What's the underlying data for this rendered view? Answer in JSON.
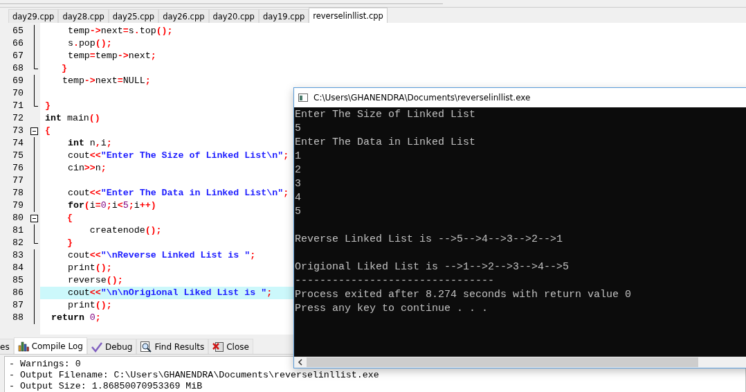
{
  "editor_tabs": [
    {
      "label": "day29.cpp",
      "selected": false
    },
    {
      "label": "day28.cpp",
      "selected": false
    },
    {
      "label": "day25.cpp",
      "selected": false
    },
    {
      "label": "day26.cpp",
      "selected": false
    },
    {
      "label": "day20.cpp",
      "selected": false
    },
    {
      "label": "day19.cpp",
      "selected": false
    },
    {
      "label": "reverselinllist.cpp",
      "selected": true
    }
  ],
  "code_lines": [
    {
      "number": "65",
      "kind": "inner",
      "current": false,
      "tokens": [
        {
          "kind": "plain",
          "text": "    temp"
        },
        {
          "kind": "symbol",
          "text": "->"
        },
        {
          "kind": "plain",
          "text": "next"
        },
        {
          "kind": "symbol",
          "text": "="
        },
        {
          "kind": "plain",
          "text": "s"
        },
        {
          "kind": "symbol",
          "text": "."
        },
        {
          "kind": "plain",
          "text": "top"
        },
        {
          "kind": "symbol",
          "text": "();"
        }
      ]
    },
    {
      "number": "66",
      "kind": "inner",
      "current": false,
      "tokens": [
        {
          "kind": "plain",
          "text": "    s"
        },
        {
          "kind": "symbol",
          "text": "."
        },
        {
          "kind": "plain",
          "text": "pop"
        },
        {
          "kind": "symbol",
          "text": "();"
        }
      ]
    },
    {
      "number": "67",
      "kind": "inner",
      "current": false,
      "tokens": [
        {
          "kind": "plain",
          "text": "    temp"
        },
        {
          "kind": "symbol",
          "text": "="
        },
        {
          "kind": "plain",
          "text": "temp"
        },
        {
          "kind": "symbol",
          "text": "->"
        },
        {
          "kind": "plain",
          "text": "next"
        },
        {
          "kind": "symbol",
          "text": ";"
        }
      ]
    },
    {
      "number": "68",
      "kind": "block_end",
      "current": false,
      "tokens": [
        {
          "kind": "symbol",
          "text": "   }"
        }
      ]
    },
    {
      "number": "69",
      "kind": "inner",
      "current": false,
      "tokens": [
        {
          "kind": "plain",
          "text": "   temp"
        },
        {
          "kind": "symbol",
          "text": "->"
        },
        {
          "kind": "plain",
          "text": "next"
        },
        {
          "kind": "symbol",
          "text": "="
        },
        {
          "kind": "plain",
          "text": "NULL"
        },
        {
          "kind": "symbol",
          "text": ";"
        }
      ]
    },
    {
      "number": "70",
      "kind": "inner",
      "current": false
    },
    {
      "number": "71",
      "kind": "block_end",
      "current": false,
      "tokens": [
        {
          "kind": "symbol",
          "text": "}"
        }
      ]
    },
    {
      "number": "72",
      "kind": "outer",
      "current": false,
      "tokens": [
        {
          "kind": "keyword",
          "text": "int"
        },
        {
          "kind": "plain",
          "text": " main"
        },
        {
          "kind": "symbol",
          "text": "()"
        }
      ]
    },
    {
      "number": "73",
      "kind": "block_start",
      "current": false,
      "tokens": [
        {
          "kind": "symbol",
          "text": "{"
        }
      ]
    },
    {
      "number": "74",
      "kind": "inner",
      "current": false,
      "tokens": [
        {
          "kind": "keyword",
          "text": "    int"
        },
        {
          "kind": "plain",
          "text": " n"
        },
        {
          "kind": "symbol",
          "text": ","
        },
        {
          "kind": "plain",
          "text": "i"
        },
        {
          "kind": "symbol",
          "text": ";"
        }
      ]
    },
    {
      "number": "75",
      "kind": "inner",
      "current": false,
      "tokens": [
        {
          "kind": "plain",
          "text": "    cout"
        },
        {
          "kind": "symbol",
          "text": "<<"
        },
        {
          "kind": "string",
          "text": "\"Enter The Size of Linked List\\n\""
        },
        {
          "kind": "symbol",
          "text": ";"
        }
      ]
    },
    {
      "number": "76",
      "kind": "inner",
      "current": false,
      "tokens": [
        {
          "kind": "plain",
          "text": "    cin"
        },
        {
          "kind": "symbol",
          "text": ">>"
        },
        {
          "kind": "plain",
          "text": "n"
        },
        {
          "kind": "symbol",
          "text": ";"
        }
      ]
    },
    {
      "number": "77",
      "kind": "inner",
      "current": false
    },
    {
      "number": "78",
      "kind": "inner",
      "current": false,
      "tokens": [
        {
          "kind": "plain",
          "text": "    cout"
        },
        {
          "kind": "symbol",
          "text": "<<"
        },
        {
          "kind": "string",
          "text": "\"Enter The Data in Linked List\\n\""
        },
        {
          "kind": "symbol",
          "text": ";"
        }
      ]
    },
    {
      "number": "79",
      "kind": "inner",
      "current": false,
      "tokens": [
        {
          "kind": "keyword",
          "text": "    for"
        },
        {
          "kind": "symbol",
          "text": "("
        },
        {
          "kind": "plain",
          "text": "i"
        },
        {
          "kind": "symbol",
          "text": "="
        },
        {
          "kind": "number",
          "text": "0"
        },
        {
          "kind": "symbol",
          "text": ";"
        },
        {
          "kind": "plain",
          "text": "i"
        },
        {
          "kind": "symbol",
          "text": "<"
        },
        {
          "kind": "number",
          "text": "5"
        },
        {
          "kind": "symbol",
          "text": ";"
        },
        {
          "kind": "plain",
          "text": "i"
        },
        {
          "kind": "symbol",
          "text": "++)"
        }
      ]
    },
    {
      "number": "80",
      "kind": "block_start",
      "current": false,
      "tokens": [
        {
          "kind": "symbol",
          "text": "    {"
        }
      ]
    },
    {
      "number": "81",
      "kind": "inner",
      "current": false,
      "tokens": [
        {
          "kind": "plain",
          "text": "        createnode"
        },
        {
          "kind": "symbol",
          "text": "();"
        }
      ]
    },
    {
      "number": "82",
      "kind": "block_end",
      "current": false,
      "tokens": [
        {
          "kind": "symbol",
          "text": "    }"
        }
      ]
    },
    {
      "number": "83",
      "kind": "inner",
      "current": false,
      "tokens": [
        {
          "kind": "plain",
          "text": "    cout"
        },
        {
          "kind": "symbol",
          "text": "<<"
        },
        {
          "kind": "string",
          "text": "\"\\nReverse Linked List is \""
        },
        {
          "kind": "symbol",
          "text": ";"
        }
      ]
    },
    {
      "number": "84",
      "kind": "inner",
      "current": false,
      "tokens": [
        {
          "kind": "plain",
          "text": "    print"
        },
        {
          "kind": "symbol",
          "text": "();"
        }
      ]
    },
    {
      "number": "85",
      "kind": "inner",
      "current": false,
      "tokens": [
        {
          "kind": "plain",
          "text": "    reverse"
        },
        {
          "kind": "symbol",
          "text": "();"
        }
      ]
    },
    {
      "number": "86",
      "kind": "inner",
      "current": true,
      "tokens": [
        {
          "kind": "plain",
          "text": "    cout"
        },
        {
          "kind": "symbol",
          "text": "<<"
        },
        {
          "kind": "string",
          "text": "\"\\n\\nOrigional Liked List is \""
        },
        {
          "kind": "symbol",
          "text": ";"
        }
      ]
    },
    {
      "number": "87",
      "kind": "inner",
      "current": false,
      "tokens": [
        {
          "kind": "plain",
          "text": "    print"
        },
        {
          "kind": "symbol",
          "text": "();"
        }
      ]
    },
    {
      "number": "88",
      "kind": "inner",
      "current": false,
      "tokens": [
        {
          "kind": "keyword",
          "text": " return"
        },
        {
          "kind": "number",
          "text": " 0"
        },
        {
          "kind": "symbol",
          "text": ";"
        }
      ]
    }
  ],
  "bottom_tabs": [
    {
      "label": "es",
      "selected": false
    },
    {
      "label": "Compile Log",
      "selected": true
    },
    {
      "label": "Debug",
      "selected": false
    },
    {
      "label": "Find Results",
      "selected": false
    },
    {
      "label": "Close",
      "selected": false
    }
  ],
  "compile_log": [
    "- Warnings: 0",
    "- Output Filename: C:\\Users\\GHANENDRA\\Documents\\reverselinllist.exe",
    "- Output Size: 1.86850070953369 MiB"
  ],
  "console": {
    "title": "C:\\Users\\GHANENDRA\\Documents\\reverselinllist.exe",
    "output_blocks": [
      [
        "Enter The Size of Linked List",
        "5",
        "Enter The Data in Linked List",
        "1",
        "2",
        "3",
        "4",
        "5"
      ],
      [
        "Reverse Linked List is -->5-->4-->3-->2-->1"
      ],
      [
        "Origional Liked List is -->1-->2-->3-->4-->5",
        "--------------------------------",
        "Process exited after 8.274 seconds with return value 0",
        "Press any key to continue . . ."
      ]
    ]
  }
}
